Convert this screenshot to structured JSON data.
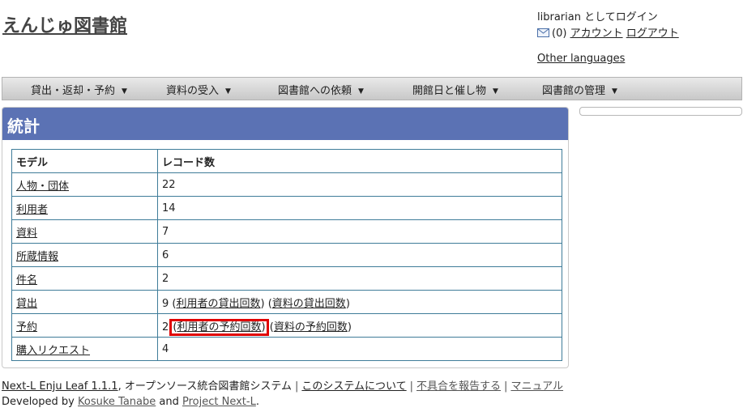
{
  "site": {
    "title": "えんじゅ図書館"
  },
  "header": {
    "login_status": "librarian としてログイン",
    "mail_count": "(0)",
    "account_link": "アカウント",
    "logout_link": "ログアウト",
    "other_languages": "Other languages"
  },
  "nav": {
    "items": [
      {
        "label": "貸出・返却・予約"
      },
      {
        "label": "資料の受入"
      },
      {
        "label": "図書館への依頼"
      },
      {
        "label": "開館日と催し物"
      },
      {
        "label": "図書館の管理"
      }
    ]
  },
  "page": {
    "title": "統計"
  },
  "table": {
    "headers": {
      "model": "モデル",
      "count": "レコード数"
    },
    "rows": [
      {
        "model": "人物・団体",
        "count": "22"
      },
      {
        "model": "利用者",
        "count": "14"
      },
      {
        "model": "資料",
        "count": "7"
      },
      {
        "model": "所蔵情報",
        "count": "6"
      },
      {
        "model": "件名",
        "count": "2"
      },
      {
        "model": "貸出",
        "count": "9",
        "links": [
          "利用者の貸出回数",
          "資料の貸出回数"
        ]
      },
      {
        "model": "予約",
        "count": "2",
        "links": [
          "利用者の予約回数",
          "資料の予約回数"
        ]
      },
      {
        "model": "購入リクエスト",
        "count": "4"
      }
    ]
  },
  "footer": {
    "version_link": "Next-L Enju Leaf 1.1.1",
    "system_desc": ", オープンソース統合図書館システム",
    "about_link": "このシステムについて",
    "report_link": "不具合を報告する",
    "manual_link": "マニュアル",
    "developed_by": "Developed by",
    "author_link": "Kosuke Tanabe",
    "and_text": "and",
    "project_link": "Project Next-L",
    "period": "."
  },
  "icons": {
    "mail": "mail-icon",
    "dropdown": "chevron-down-icon"
  },
  "colors": {
    "header_bar": "#5b72b4",
    "table_border": "#3f7c99",
    "highlight": "#e00000"
  }
}
